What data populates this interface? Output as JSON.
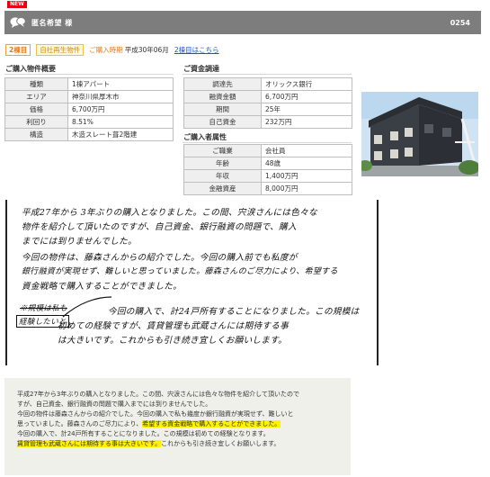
{
  "badge": "NEW",
  "header": {
    "title": "匿名希望 様",
    "number": "0254"
  },
  "tags": {
    "floor": "2棟目",
    "self": "自社再生物件",
    "period_label": "ご購入時期",
    "period_value": "平成30年06月",
    "link": "2棟目はこちら"
  },
  "property": {
    "title": "ご購入物件概要",
    "rows": [
      {
        "key": "種類",
        "value": "1棟アパート"
      },
      {
        "key": "エリア",
        "value": "神奈川県厚木市"
      },
      {
        "key": "価格",
        "value": "6,700万円"
      },
      {
        "key": "利回り",
        "value": "8.51%"
      },
      {
        "key": "構造",
        "value": "木造スレート葺2階建"
      }
    ]
  },
  "funding": {
    "title": "ご資金調達",
    "rows": [
      {
        "key": "調達先",
        "value": "オリックス銀行"
      },
      {
        "key": "融資金額",
        "value": "6,700万円"
      },
      {
        "key": "期間",
        "value": "25年"
      },
      {
        "key": "自己資金",
        "value": "232万円"
      }
    ]
  },
  "buyer": {
    "title": "ご購入者属性",
    "rows": [
      {
        "key": "ご職業",
        "value": "会社員"
      },
      {
        "key": "年齢",
        "value": "48歳"
      },
      {
        "key": "年収",
        "value": "1,400万円"
      },
      {
        "key": "金融資産",
        "value": "8,000万円"
      }
    ]
  },
  "memo": {
    "lines": [
      "平成27年から 3年ぶりの購入となりました。この間、宍涙さんには色々な",
      "物件を紹介して頂いたのですが、自己資金、銀行融資の問題で、購入",
      "までには到りませんでした。",
      "今回の物件は、藤森さんからの紹介でした。今回の購入前でも私度が",
      "銀行融資が実現せず、難しいと思っていました。藤森さんのご尽力により、希望する",
      "資金戦略で購入することができました。",
      "今回の購入で、計24戸所有することになりました。この規模は",
      "初めての経験ですが、賃貸管理も武蔵さんには期待する事",
      "は大きいです。これからも引き続き宜しくお願いします。"
    ],
    "margin_note": "※規模は私も",
    "margin_note2": "経験したいと"
  },
  "quote": {
    "lines": [
      [
        {
          "t": "平成27年から3年ぶりの購入となりました。この間、宍涙さんには色々な物件を紹介して頂いたので"
        }
      ],
      [
        {
          "t": "すが、自己資金、銀行融資の問題で購入までには到りませんでした。"
        }
      ],
      [
        {
          "t": "今回の物件は藤森さんからの紹介でした。今回の購入で私も幾度か銀行融資が実現せず、難しいと"
        }
      ],
      [
        {
          "t": "思っていました。藤森さんのご尽力により、"
        },
        {
          "t": "希望する資金戦略で購入することができました。",
          "hl": true
        }
      ],
      [
        {
          "t": "今回の購入で、計24戸所有することになりました。この規模は初めての経験となります。"
        }
      ],
      [
        {
          "t": "賃貸管理も武蔵さんには期待する事は大きいです。",
          "hl": true
        },
        {
          "t": "これからも引き続き宜しくお願いします。"
        }
      ]
    ]
  }
}
